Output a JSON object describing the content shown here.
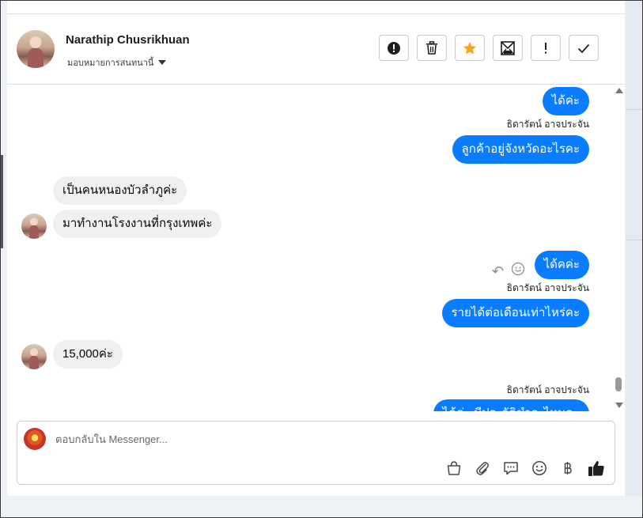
{
  "header": {
    "contact_name": "Narathip Chusrikhuan",
    "assign_label": "มอบหมายการสนทนานี้",
    "actions": [
      {
        "id": "report",
        "icon": "alert-circle-icon"
      },
      {
        "id": "delete",
        "icon": "trash-icon"
      },
      {
        "id": "star",
        "icon": "star-icon",
        "color": "#f5a623"
      },
      {
        "id": "mark",
        "icon": "envelope-icon"
      },
      {
        "id": "spam",
        "icon": "exclamation-icon"
      },
      {
        "id": "done",
        "icon": "check-icon"
      }
    ]
  },
  "messages": [
    {
      "direction": "outgoing",
      "text": "ได้ค่ะ"
    },
    {
      "direction": "outgoing",
      "sender": "ธิดารัตน์ อาจประจัน",
      "text": "ลูกค้าอยู่จังหวัดอะไรคะ"
    },
    {
      "direction": "incoming",
      "text": "เป็นคนหนองบัวลำภูค่ะ"
    },
    {
      "direction": "incoming",
      "text": "มาทำงานโรงงานที่กรุงเทพค่ะ"
    },
    {
      "direction": "outgoing",
      "text": "ได้คค่ะ"
    },
    {
      "direction": "outgoing",
      "sender": "ธิดารัตน์ อาจประจัน",
      "text": "รายได้ต่อเดือนเท่าไหร่คะ"
    },
    {
      "direction": "incoming",
      "text": "15,000ค่ะ"
    },
    {
      "direction": "outgoing",
      "sender": "ธิดารัตน์ อาจประจัน",
      "text": "ได้ค่ะ มีประวัติชำระไหมคะ"
    }
  ],
  "composer": {
    "placeholder": "ตอบกลับใน Messenger...",
    "icons": [
      "shopping-bag-icon",
      "paperclip-icon",
      "message-bubble-icon",
      "emoji-icon",
      "baht-icon",
      "thumbs-up-icon"
    ]
  },
  "colors": {
    "outgoing_bubble": "#0a7cff",
    "incoming_bubble": "#f0f0f0",
    "star": "#f5a623"
  }
}
